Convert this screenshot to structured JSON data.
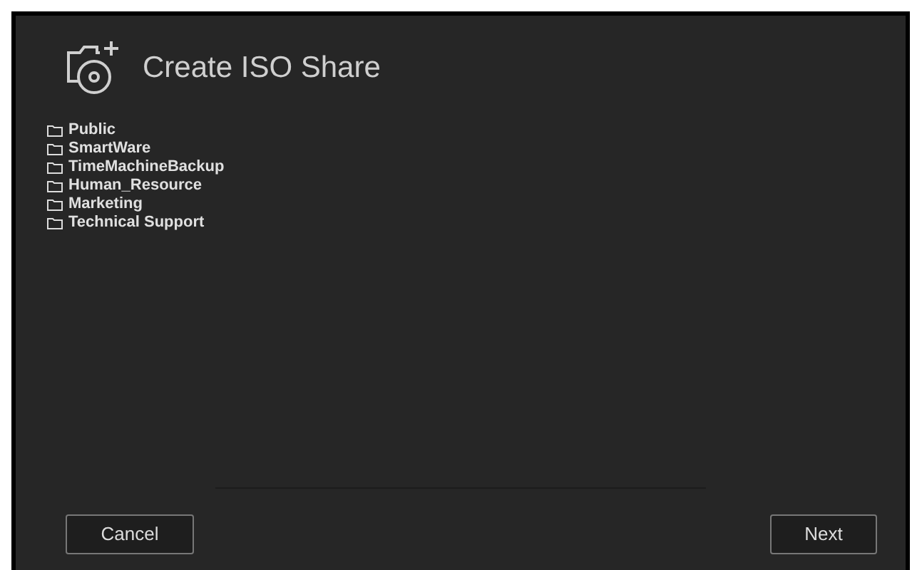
{
  "dialog": {
    "title": "Create ISO Share"
  },
  "shares": [
    {
      "name": "Public"
    },
    {
      "name": "SmartWare"
    },
    {
      "name": "TimeMachineBackup"
    },
    {
      "name": "Human_Resource"
    },
    {
      "name": "Marketing"
    },
    {
      "name": "Technical Support"
    }
  ],
  "buttons": {
    "cancel": "Cancel",
    "next": "Next"
  }
}
